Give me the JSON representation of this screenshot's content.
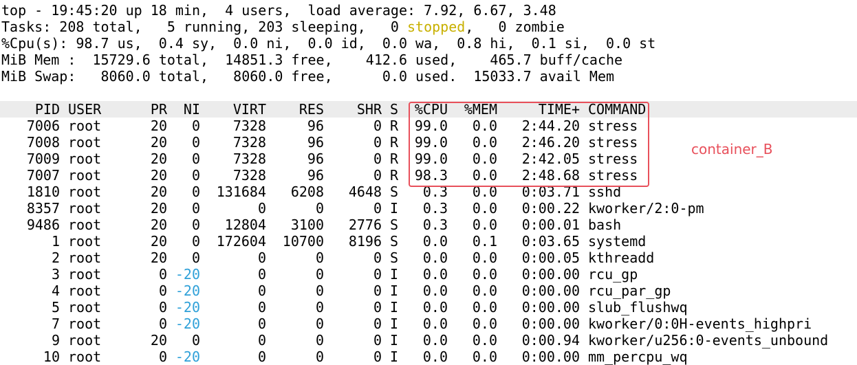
{
  "summary": {
    "line1": "top - 19:45:20 up 18 min,  4 users,  load average: 7.92, 6.67, 3.48",
    "line2_pre": "Tasks: 208 total,   5 running, 203 sleeping,   0 ",
    "line2_stopped": "stopped",
    "line2_post": ",   0 zombie",
    "line3": "%Cpu(s): 98.7 us,  0.4 sy,  0.0 ni,  0.0 id,  0.0 wa,  0.8 hi,  0.1 si,  0.0 st",
    "line4": "MiB Mem :  15729.6 total,  14851.3 free,    412.6 used,    465.7 buff/cache",
    "line5": "MiB Swap:   8060.0 total,   8060.0 free,      0.0 used.  15033.7 avail Mem"
  },
  "table": {
    "headers": {
      "pid": "PID",
      "user": "USER",
      "pr": "PR",
      "ni": "NI",
      "virt": "VIRT",
      "res": "RES",
      "shr": "SHR",
      "s": "S",
      "cpu": "%CPU",
      "mem": "%MEM",
      "time": "TIME+",
      "command": "COMMAND"
    },
    "rows": [
      {
        "pid": "7006",
        "user": "root",
        "pr": "20",
        "ni": "0",
        "virt": "7328",
        "res": "96",
        "shr": "0",
        "s": "R",
        "cpu": "99.0",
        "mem": "0.0",
        "time": "2:44.20",
        "command": "stress"
      },
      {
        "pid": "7008",
        "user": "root",
        "pr": "20",
        "ni": "0",
        "virt": "7328",
        "res": "96",
        "shr": "0",
        "s": "R",
        "cpu": "99.0",
        "mem": "0.0",
        "time": "2:46.20",
        "command": "stress"
      },
      {
        "pid": "7009",
        "user": "root",
        "pr": "20",
        "ni": "0",
        "virt": "7328",
        "res": "96",
        "shr": "0",
        "s": "R",
        "cpu": "99.0",
        "mem": "0.0",
        "time": "2:42.05",
        "command": "stress"
      },
      {
        "pid": "7007",
        "user": "root",
        "pr": "20",
        "ni": "0",
        "virt": "7328",
        "res": "96",
        "shr": "0",
        "s": "R",
        "cpu": "98.3",
        "mem": "0.0",
        "time": "2:48.68",
        "command": "stress"
      },
      {
        "pid": "1810",
        "user": "root",
        "pr": "20",
        "ni": "0",
        "virt": "131684",
        "res": "6208",
        "shr": "4648",
        "s": "S",
        "cpu": "0.3",
        "mem": "0.0",
        "time": "0:03.71",
        "command": "sshd"
      },
      {
        "pid": "8357",
        "user": "root",
        "pr": "20",
        "ni": "0",
        "virt": "0",
        "res": "0",
        "shr": "0",
        "s": "I",
        "cpu": "0.3",
        "mem": "0.0",
        "time": "0:00.22",
        "command": "kworker/2:0-pm"
      },
      {
        "pid": "9486",
        "user": "root",
        "pr": "20",
        "ni": "0",
        "virt": "12804",
        "res": "3100",
        "shr": "2776",
        "s": "S",
        "cpu": "0.3",
        "mem": "0.0",
        "time": "0:00.01",
        "command": "bash"
      },
      {
        "pid": "1",
        "user": "root",
        "pr": "20",
        "ni": "0",
        "virt": "172604",
        "res": "10700",
        "shr": "8196",
        "s": "S",
        "cpu": "0.0",
        "mem": "0.1",
        "time": "0:03.65",
        "command": "systemd"
      },
      {
        "pid": "2",
        "user": "root",
        "pr": "20",
        "ni": "0",
        "virt": "0",
        "res": "0",
        "shr": "0",
        "s": "S",
        "cpu": "0.0",
        "mem": "0.0",
        "time": "0:00.05",
        "command": "kthreadd"
      },
      {
        "pid": "3",
        "user": "root",
        "pr": "0",
        "ni": "-20",
        "virt": "0",
        "res": "0",
        "shr": "0",
        "s": "I",
        "cpu": "0.0",
        "mem": "0.0",
        "time": "0:00.00",
        "command": "rcu_gp"
      },
      {
        "pid": "4",
        "user": "root",
        "pr": "0",
        "ni": "-20",
        "virt": "0",
        "res": "0",
        "shr": "0",
        "s": "I",
        "cpu": "0.0",
        "mem": "0.0",
        "time": "0:00.00",
        "command": "rcu_par_gp"
      },
      {
        "pid": "5",
        "user": "root",
        "pr": "0",
        "ni": "-20",
        "virt": "0",
        "res": "0",
        "shr": "0",
        "s": "I",
        "cpu": "0.0",
        "mem": "0.0",
        "time": "0:00.00",
        "command": "slub_flushwq"
      },
      {
        "pid": "7",
        "user": "root",
        "pr": "0",
        "ni": "-20",
        "virt": "0",
        "res": "0",
        "shr": "0",
        "s": "I",
        "cpu": "0.0",
        "mem": "0.0",
        "time": "0:00.00",
        "command": "kworker/0:0H-events_highpri"
      },
      {
        "pid": "9",
        "user": "root",
        "pr": "20",
        "ni": "0",
        "virt": "0",
        "res": "0",
        "shr": "0",
        "s": "I",
        "cpu": "0.0",
        "mem": "0.0",
        "time": "0:00.94",
        "command": "kworker/u256:0-events_unbound"
      },
      {
        "pid": "10",
        "user": "root",
        "pr": "0",
        "ni": "-20",
        "virt": "0",
        "res": "0",
        "shr": "0",
        "s": "I",
        "cpu": "0.0",
        "mem": "0.0",
        "time": "0:00.00",
        "command": "mm_percpu_wq"
      }
    ]
  },
  "annotation": {
    "label": "container_B",
    "color": "#e8505b"
  },
  "colors": {
    "stopped": "#c8b000",
    "negative_nice": "#2ea0d8",
    "header_bg": "#ececec"
  }
}
